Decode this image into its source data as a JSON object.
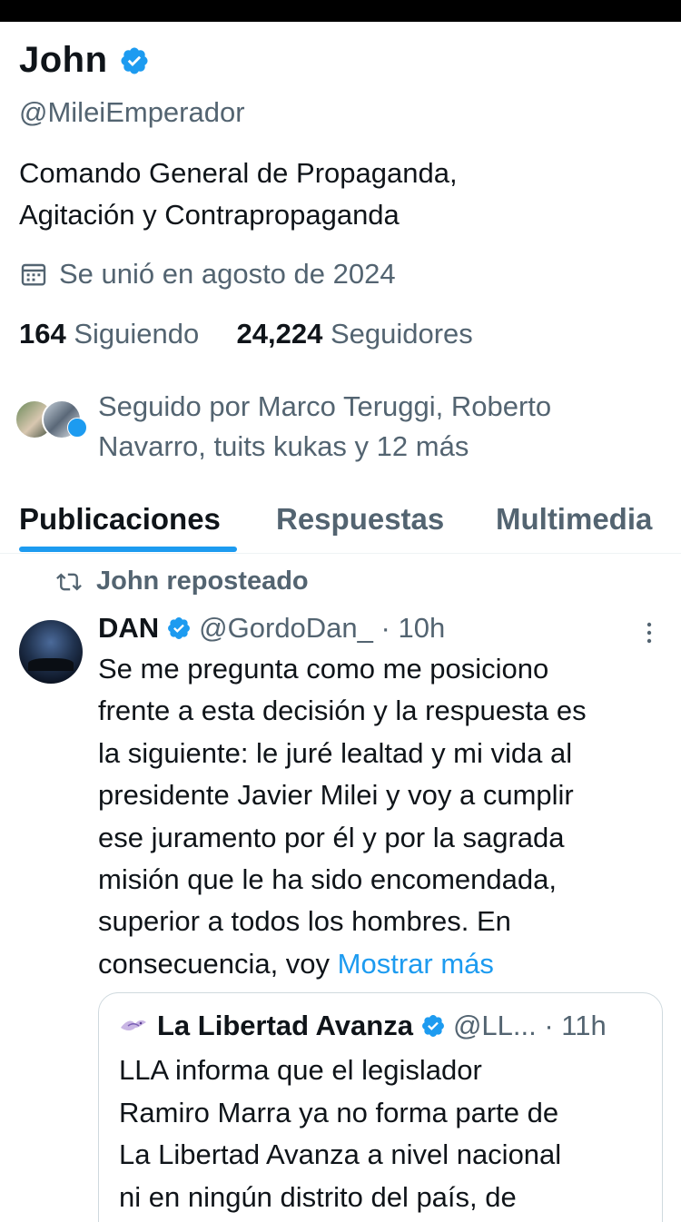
{
  "profile": {
    "name": "John",
    "handle": "@MileiEmperador",
    "bio_line1": "Comando General de Propaganda,",
    "bio_line2": "Agitación y Contrapropaganda",
    "joined": "Se unió en agosto de 2024",
    "following_count": "164",
    "following_label": "Siguiendo",
    "followers_count": "24,224",
    "followers_label": "Seguidores",
    "followed_by_line1": "Seguido por Marco Teruggi, Roberto",
    "followed_by_line2": "Navarro, tuits kukas y 12 más"
  },
  "tabs": [
    {
      "label": "Publicaciones",
      "active": true
    },
    {
      "label": "Respuestas",
      "active": false
    },
    {
      "label": "Multimedia",
      "active": false
    }
  ],
  "post": {
    "repost_label": "John reposteado",
    "author_name": "DAN",
    "author_handle": "@GordoDan_",
    "time": "10h",
    "lines": [
      "Se me pregunta como me posiciono",
      "frente a esta decisión y la respuesta es",
      "la siguiente: le juré lealtad y mi vida al",
      "presidente Javier Milei y voy a cumplir",
      "ese juramento por él y por la sagrada",
      "misión que le ha sido encomendada,",
      "superior a todos los hombres. En",
      "consecuencia, voy"
    ],
    "show_more": "Mostrar más"
  },
  "quote": {
    "name": "La Libertad Avanza",
    "handle": "@LL...",
    "time": "11h",
    "lines": [
      "LLA informa que el legislador",
      "Ramiro Marra ya no forma parte de",
      "La Libertad Avanza a nivel nacional",
      "ni en ningún distrito del país, de"
    ]
  },
  "colors": {
    "accent": "#1d9bf0",
    "text": "#0f1419",
    "muted": "#536471"
  },
  "icons": [
    "verified-badge-icon",
    "calendar-icon",
    "repost-icon",
    "more-options-icon",
    "lla-logo-icon"
  ]
}
